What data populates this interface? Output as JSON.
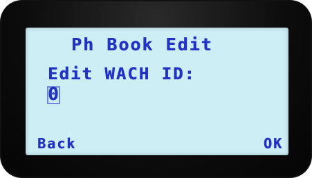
{
  "screen": {
    "title": "Ph Book Edit",
    "prompt": "Edit WACH ID:",
    "value": "0"
  },
  "softkeys": {
    "left": "Back",
    "right": "OK"
  },
  "colors": {
    "lcd_background": "#cdeef5",
    "lcd_text": "#2233c4",
    "bezel": "#111111"
  }
}
